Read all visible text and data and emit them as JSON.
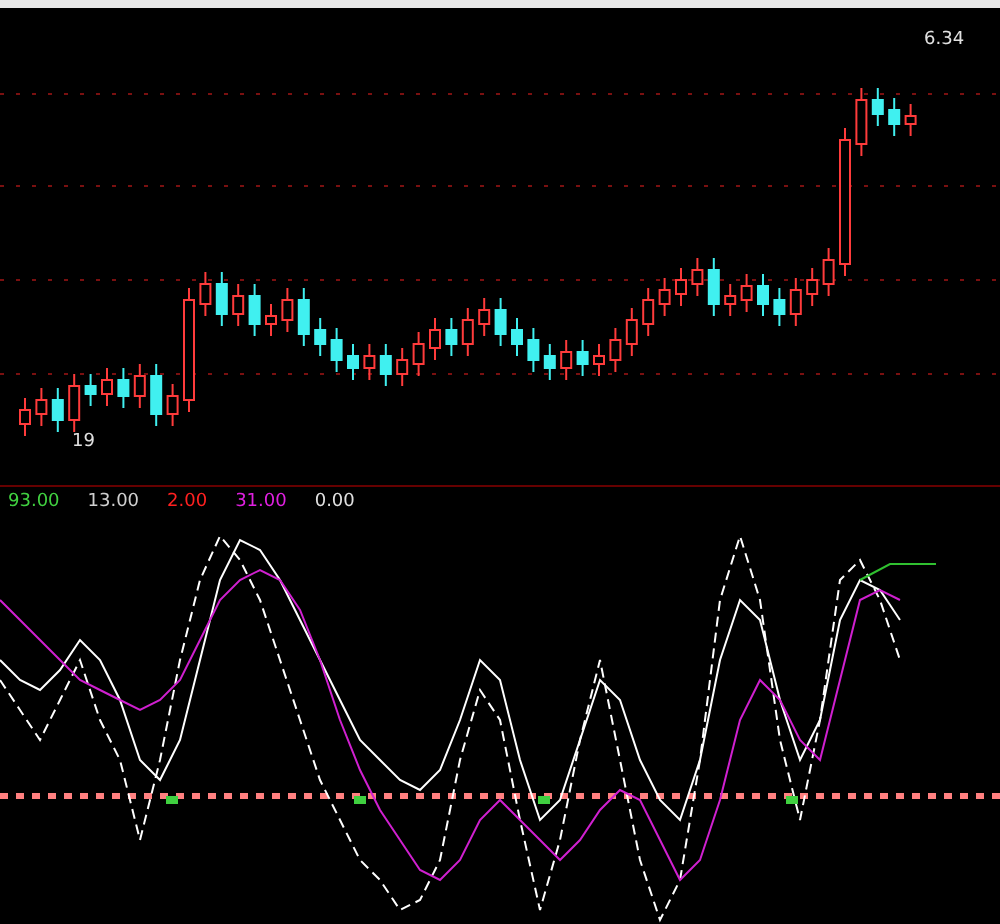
{
  "price_chart": {
    "high_label": "6.34",
    "low_label": "19"
  },
  "indicator": {
    "legend": [
      {
        "value": "93.00",
        "color": "#40d040"
      },
      {
        "value": "13.00",
        "color": "#d0d0d0"
      },
      {
        "value": "2.00",
        "color": "#ff2020"
      },
      {
        "value": "31.00",
        "color": "#e020e0"
      },
      {
        "value": "0.00",
        "color": "#e0e0e0"
      }
    ]
  }
}
